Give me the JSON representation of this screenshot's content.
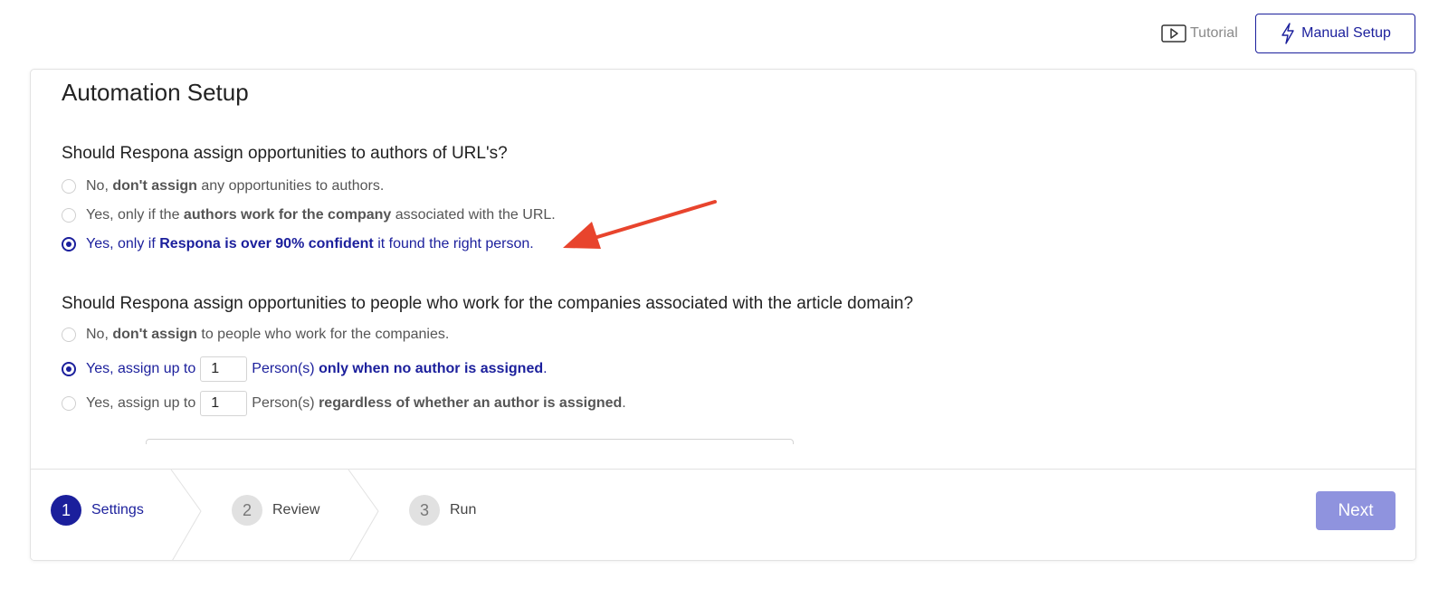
{
  "header": {
    "tutorial_label": "Tutorial",
    "manual_setup_label": "Manual Setup"
  },
  "card": {
    "title": "Automation Setup",
    "question1": {
      "text": "Should Respona assign opportunities to authors of URL's?",
      "options": [
        {
          "pre": "No, ",
          "bold": "don't assign",
          "post": " any opportunities to authors.",
          "selected": false
        },
        {
          "pre": "Yes, only if the ",
          "bold": "authors work for the company",
          "post": " associated with the URL.",
          "selected": false
        },
        {
          "pre": "Yes, only if ",
          "bold": "Respona is over 90% confident",
          "post": " it found the right person.",
          "selected": true
        }
      ]
    },
    "question2": {
      "text": "Should Respona assign opportunities to people who work for the companies associated with the article domain?",
      "options": [
        {
          "pre": "No, ",
          "bold": "don't assign",
          "post": " to people who work for the companies.",
          "selected": false
        },
        {
          "pre": "Yes, assign up to",
          "value": "1",
          "mid": "Person(s) ",
          "bold": "only when no author is assigned",
          "post": ".",
          "selected": true
        },
        {
          "pre": "Yes, assign up to",
          "value": "1",
          "mid": "Person(s) ",
          "bold": "regardless of whether an author is assigned",
          "post": ".",
          "selected": false
        }
      ]
    }
  },
  "stepper": {
    "steps": [
      {
        "number": "1",
        "label": "Settings",
        "active": true
      },
      {
        "number": "2",
        "label": "Review",
        "active": false
      },
      {
        "number": "3",
        "label": "Run",
        "active": false
      }
    ],
    "next_label": "Next"
  },
  "colors": {
    "brand": "#1b1f9c",
    "next_disabled": "#8f93de",
    "annotation_arrow": "#e8442d"
  }
}
